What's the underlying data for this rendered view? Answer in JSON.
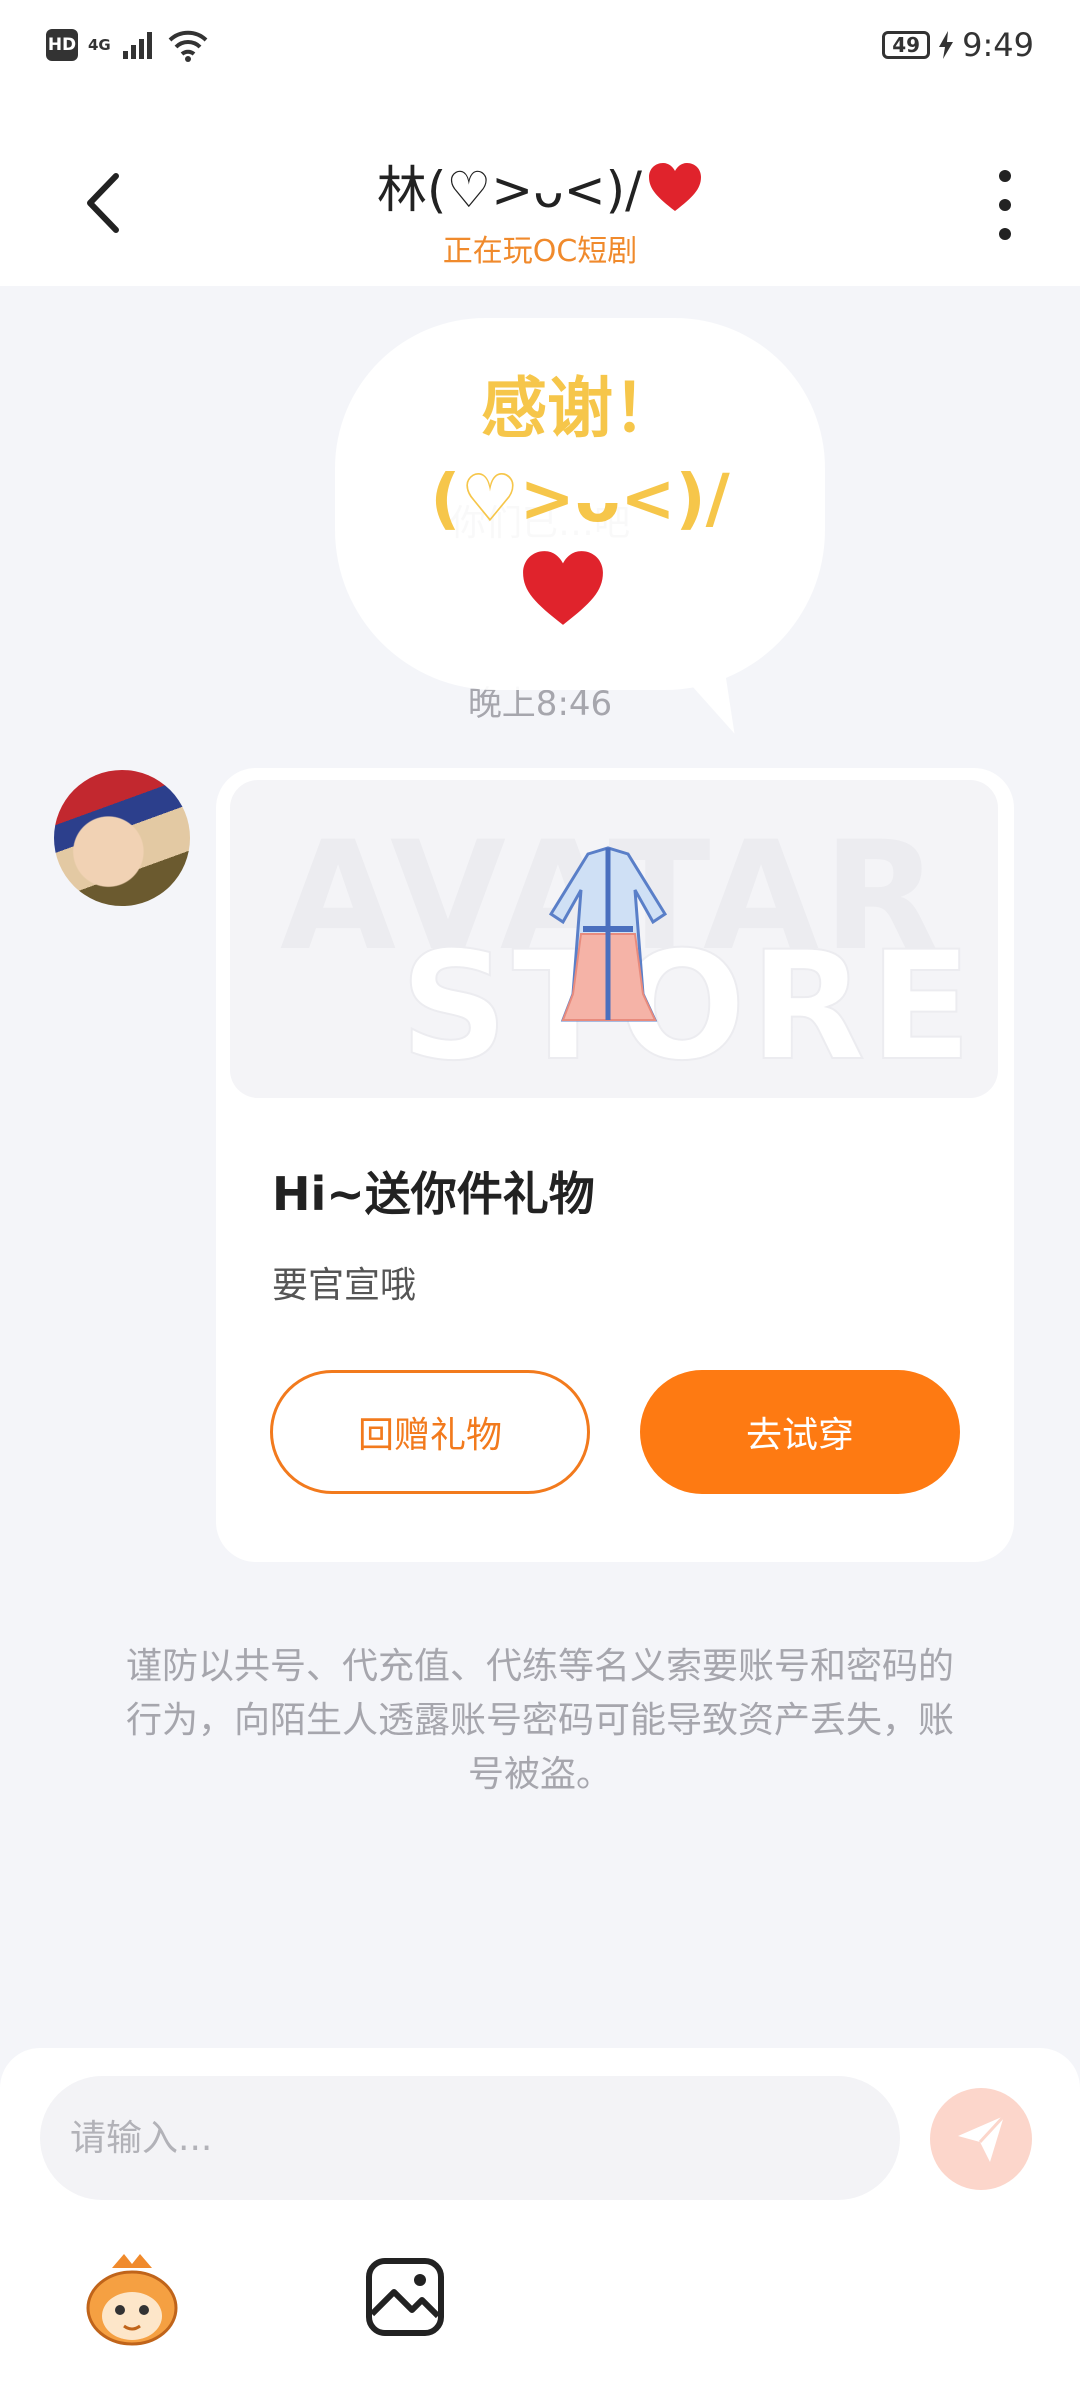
{
  "status_bar": {
    "hd": "HD",
    "network": "4G",
    "battery": "49",
    "time": "9:49"
  },
  "header": {
    "title": "林(♡>ᴗ<)/",
    "subtitle": "正在玩OC短剧"
  },
  "chat": {
    "system_message": "你们已…吧",
    "timestamp": "晚上8:46",
    "popup_text": "感谢！(♡>ᴗ<)/"
  },
  "gift_card": {
    "watermark_line1": "AVATAR",
    "watermark_line2": "STORE",
    "title": "Hi~送你件礼物",
    "description": "要官宣哦",
    "return_gift_label": "回赠礼物",
    "try_on_label": "去试穿"
  },
  "warning": "谨防以共号、代充值、代练等名义索要账号和密码的行为，向陌生人透露账号密码可能导致资产丢失，账号被盗。",
  "input_bar": {
    "placeholder": "请输入..."
  },
  "colors": {
    "accent": "#fe7a12",
    "subtitle": "#f08a2c",
    "popup_text": "#f6c64a",
    "heart": "#e0232c"
  },
  "icons": [
    "back-icon",
    "more-icon",
    "heart-icon",
    "send-icon",
    "mascot-icon",
    "image-icon",
    "wifi-icon",
    "signal-icon",
    "charging-icon"
  ]
}
